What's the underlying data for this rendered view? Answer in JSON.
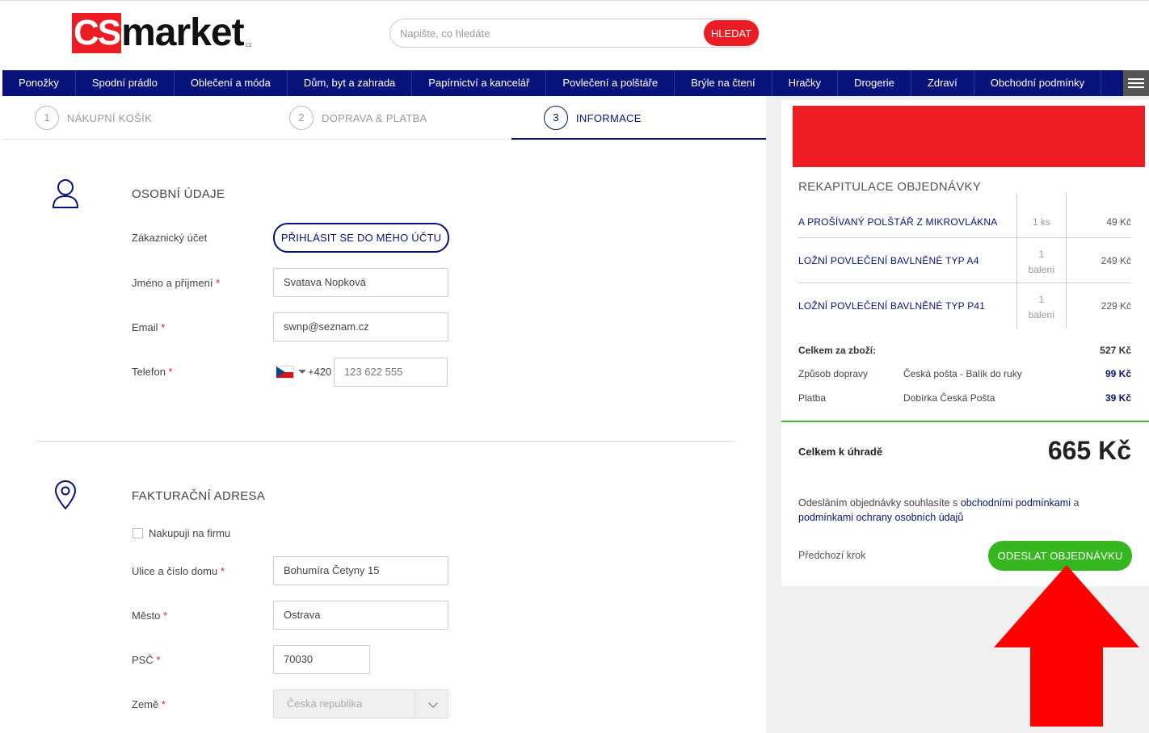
{
  "header": {
    "logo_cs": "CS",
    "logo_market": "market",
    "logo_cz": "cz",
    "search_placeholder": "Napište, co hledáte",
    "search_button": "HLEDAT"
  },
  "nav": {
    "items": [
      "Ponožky",
      "Spodní prádlo",
      "Oblečení a móda",
      "Dům, byt a zahrada",
      "Papírnictví a kancelář",
      "Povlečení a polštáře",
      "Brýle na čtení",
      "Hračky",
      "Drogerie",
      "Zdraví",
      "Obchodní podmínky"
    ],
    "menu_icon": "hamburger-icon"
  },
  "steps": [
    {
      "num": "1",
      "label": "NÁKUPNÍ KOŠÍK"
    },
    {
      "num": "2",
      "label": "DOPRAVA & PLATBA"
    },
    {
      "num": "3",
      "label": "INFORMACE"
    }
  ],
  "personal": {
    "title": "OSOBNÍ ÚDAJE",
    "account_label": "Zákaznický účet",
    "login_button": "PŘIHLÁSIT SE DO MÉHO ÚČTU",
    "name_label": "Jméno a příjmení",
    "name_value": "Svatava Nopková",
    "email_label": "Email",
    "email_value": "swnp@seznam.cz",
    "phone_label": "Telefon",
    "phone_prefix": "+420",
    "phone_value": "123 622 555",
    "required_mark": "*"
  },
  "billing": {
    "title": "FAKTURAČNÍ ADRESA",
    "company_checkbox": "Nakupuji na firmu",
    "street_label": "Ulice a číslo domu",
    "street_value": "Bohumíra Četyny 15",
    "city_label": "Město",
    "city_value": "Ostrava",
    "zip_label": "PSČ",
    "zip_value": "70030",
    "country_label": "Země",
    "country_value": "Česká republika"
  },
  "summary": {
    "title": "REKAPITULACE OBJEDNÁVKY",
    "items": [
      {
        "name": "A PROŠÍVANÝ POLŠTÁŘ Z MIKROVLÁKNA",
        "qty": "1  ks",
        "qty2": "",
        "price": "49 Kč"
      },
      {
        "name": "LOŽNÍ POVLEČENÍ BAVLNĚNÉ TYP A4",
        "qty": "1",
        "qty2": "balení",
        "price": "249 Kč"
      },
      {
        "name": "LOŽNÍ POVLEČENÍ BAVLNĚNÉ TYP P41",
        "qty": "1",
        "qty2": "balení",
        "price": "229 Kč"
      }
    ],
    "goods_total_label": "Celkem za zboží:",
    "goods_total_value": "527 Kč",
    "shipping_label": "Způsob dopravy",
    "shipping_method": "Česká pošta - Balík do ruky",
    "shipping_price": "99 Kč",
    "payment_label": "Platba",
    "payment_method": "Dobírka Česká Pošta",
    "payment_price": "39 Kč",
    "total_label": "Celkem k úhradě",
    "total_value": "665 Kč",
    "consent_prefix": "Odesláním objednávky souhlasíte s ",
    "consent_link1": "obchodními podmínkami",
    "consent_mid": " a ",
    "consent_link2": "podmínkami ochrany osobních údajů",
    "prev_step": "Předchozí krok",
    "submit_button": "ODESLAT OBJEDNÁVKU"
  },
  "colors": {
    "brand_blue": "#07137a",
    "brand_red": "#ec1c24",
    "accent_green": "#36b71f"
  }
}
